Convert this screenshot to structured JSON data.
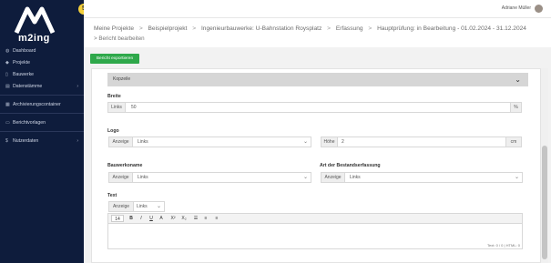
{
  "brand": {
    "name": "m2ing",
    "badge": "5"
  },
  "sidebar": {
    "items": [
      {
        "label": "Dashboard",
        "icon": "dashboard-icon",
        "glyph": "◍"
      },
      {
        "label": "Projekte",
        "icon": "projects-icon",
        "glyph": "◆"
      },
      {
        "label": "Bauwerke",
        "icon": "building-icon",
        "glyph": "▯"
      },
      {
        "label": "Datenstämme",
        "icon": "data-icon",
        "glyph": "▤",
        "chevron": "›"
      },
      {
        "label": "Archivierungscontainer",
        "icon": "archive-icon",
        "glyph": "▦"
      },
      {
        "label": "Berichtvorlagen",
        "icon": "template-icon",
        "glyph": "▭"
      },
      {
        "label": "Nutzerdaten",
        "icon": "user-data-icon",
        "glyph": "$",
        "chevron": "›"
      }
    ]
  },
  "topbar": {
    "user_name": "Adriane Müller"
  },
  "breadcrumb": {
    "items": [
      "Meine Projekte",
      "Beispielprojekt",
      "Ingenieurbauwerke: U-Bahnstation Roysplatz",
      "Erfassung",
      "Hauptprüfung: in Bearbeitung - 01.02.2024 - 31.12.2024"
    ],
    "separator": ">",
    "current": "Bericht bearbeiten"
  },
  "toolbar": {
    "export_label": "Bericht exportieren"
  },
  "panel": {
    "title": "Kopzeile",
    "collapse_glyph": "⌄"
  },
  "form": {
    "width": {
      "label": "Breite",
      "addon": "Links",
      "value": "50",
      "unit": "%"
    },
    "logo": {
      "label": "Logo",
      "addon": "Anzeige",
      "value": "Links",
      "height_addon": "Höhe",
      "height_value": "2",
      "height_unit": "cm"
    },
    "building_name": {
      "label": "Bauwerkoname",
      "addon": "Anzeige",
      "value": "Links"
    },
    "survey_type": {
      "label": "Art der Bestandserfassung",
      "addon": "Anzeige",
      "value": "Links"
    },
    "text": {
      "label": "Text",
      "addon": "Anzeige",
      "value": "Links"
    }
  },
  "editor": {
    "font_size": "14",
    "buttons": [
      "B",
      "I",
      "U",
      "A",
      "X²",
      "X₂",
      "☰",
      "≡",
      "≡"
    ],
    "status": "Text: 0 / 0 | HTML: 0"
  },
  "dropdown_glyph": "⌄"
}
